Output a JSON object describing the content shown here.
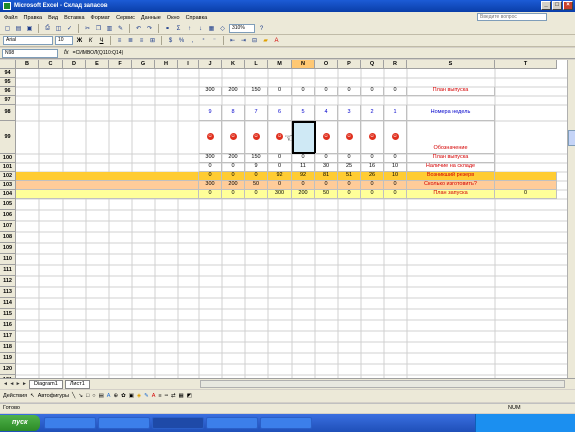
{
  "window": {
    "title": "Microsoft Excel - Склад запасов"
  },
  "menu": {
    "items": [
      "Файл",
      "Правка",
      "Вид",
      "Вставка",
      "Формат",
      "Сервис",
      "Данные",
      "Окно",
      "Справка"
    ]
  },
  "help_placeholder": "Введите вопрос",
  "toolbar": {
    "font": "Arial",
    "size": "10",
    "zoom": "310%"
  },
  "formula_bar": {
    "cell_ref": "N98",
    "fx": "fx",
    "formula": "=СИМВОЛ(Q110:Q14)"
  },
  "columns": [
    "B",
    "C",
    "D",
    "E",
    "F",
    "G",
    "H",
    "I",
    "J",
    "K",
    "L",
    "M",
    "N",
    "O",
    "P",
    "Q",
    "R",
    "S",
    "T"
  ],
  "rows": [
    "94",
    "95",
    "96",
    "97",
    "98",
    "99",
    "100",
    "101",
    "102",
    "103",
    "104",
    "105",
    "106",
    "107",
    "108",
    "109",
    "110",
    "111",
    "112",
    "113",
    "114",
    "115",
    "116",
    "117",
    "118",
    "119",
    "120",
    "121"
  ],
  "row96": {
    "values": [
      "300",
      "200",
      "150",
      "0",
      "0",
      "0",
      "0",
      "0",
      "0"
    ],
    "label": "План выпуска"
  },
  "row98": {
    "values": [
      "9",
      "8",
      "7",
      "6",
      "5",
      "4",
      "3",
      "2",
      "1"
    ],
    "label": "Номера недель"
  },
  "row99": {
    "label": "Обозначение"
  },
  "row100": {
    "values": [
      "300",
      "200",
      "150",
      "0",
      "0",
      "0",
      "0",
      "0",
      "0"
    ],
    "label": "План выпуска"
  },
  "row101": {
    "values": [
      "0",
      "0",
      "9",
      "0",
      "11",
      "30",
      "25",
      "16",
      "10"
    ],
    "label": "Наличие на складе"
  },
  "row102": {
    "values": [
      "0",
      "0",
      "0",
      "92",
      "92",
      "81",
      "51",
      "26",
      "10"
    ],
    "label": "Возникший резерв"
  },
  "row103": {
    "values": [
      "300",
      "200",
      "50",
      "0",
      "0",
      "0",
      "0",
      "0",
      "0"
    ],
    "label": "Сколько изготовить?"
  },
  "row104": {
    "values": [
      "0",
      "0",
      "0",
      "300",
      "200",
      "50",
      "0",
      "0",
      "0"
    ],
    "label": "План запуска",
    "t_value": "0"
  },
  "sheet_tabs": [
    "Diagram1",
    "Лист1"
  ],
  "nav": "◄ ◄ ► ►",
  "drawbar": {
    "actions": "Действия",
    "autoshapes": "Автофигуры"
  },
  "status": {
    "left": "Готово",
    "num": "NUM"
  },
  "taskbar": {
    "start": "пуск"
  }
}
